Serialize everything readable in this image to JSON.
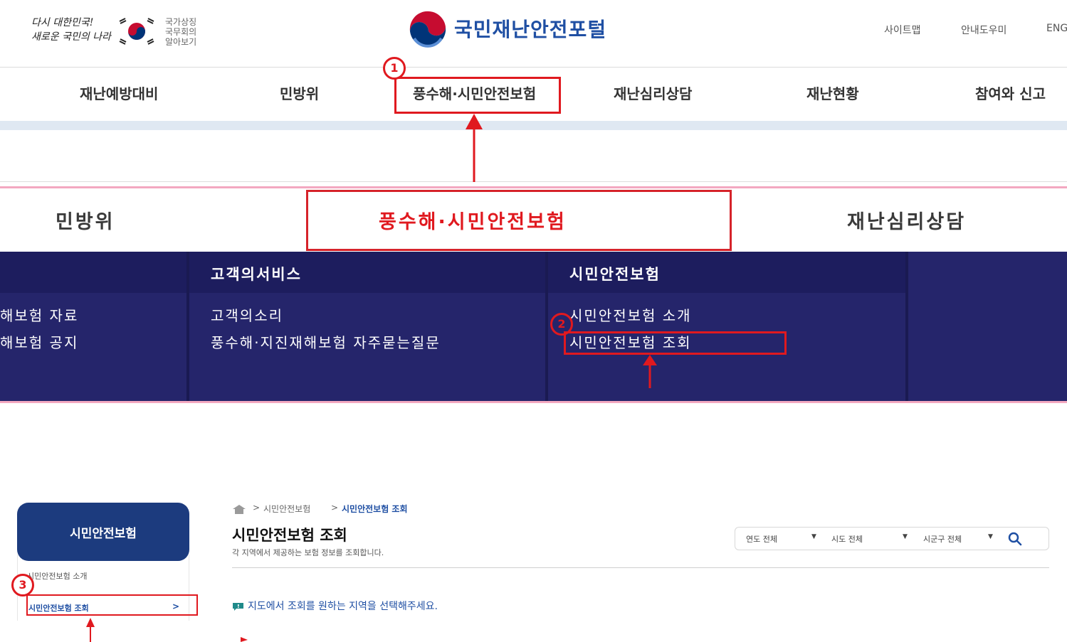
{
  "header": {
    "slogan_line1": "다시 대한민국!",
    "slogan_line2": "새로운 국민의 나라",
    "governance_lines": [
      "국가상징",
      "국무회의",
      "알아보기"
    ],
    "logo_text": "국민재난안전포털",
    "utility_links": [
      "사이트맵",
      "안내도우미",
      "ENG"
    ]
  },
  "gnb": {
    "items": [
      "재난예방대비",
      "민방위",
      "풍수해·시민안전보험",
      "재난심리상담",
      "재난현황",
      "참여와 신고"
    ]
  },
  "zoom_tabs": {
    "items": [
      "민방위",
      "풍수해·시민안전보험",
      "재난심리상담"
    ]
  },
  "mega_menu": {
    "col_a_items": [
      "해보험 자료",
      "해보험 공지"
    ],
    "col_b_head": "고객의서비스",
    "col_b_items": [
      "고객의소리",
      "풍수해·지진재해보험 자주묻는질문"
    ],
    "col_c_head": "시민안전보험",
    "col_c_items": [
      "시민안전보험 소개",
      "시민안전보험 조회"
    ]
  },
  "lnb": {
    "title": "시민안전보험",
    "items": [
      "시민안전보험 소개",
      "시민안전보험 조회"
    ],
    "chevron": ">"
  },
  "breadcrumb": {
    "separator": ">",
    "items": [
      "시민안전보험",
      "시민안전보험 조회"
    ]
  },
  "page": {
    "title": "시민안전보험 조회",
    "description": "각 지역에서 제공하는 보험 정보를 조회합니다."
  },
  "filters": {
    "year": "연도 전체",
    "sido": "시도 전체",
    "sigungu": "시군구 전체"
  },
  "notice": "지도에서 조회를 원하는 지역을 선택해주세요.",
  "annotations": {
    "step1": "1",
    "step2": "2",
    "step3": "3",
    "color": "#e0191f"
  },
  "colors": {
    "brand_blue": "#1f4fa3",
    "menu_navy": "#25256b",
    "lnb_navy": "#1c3b7e"
  }
}
